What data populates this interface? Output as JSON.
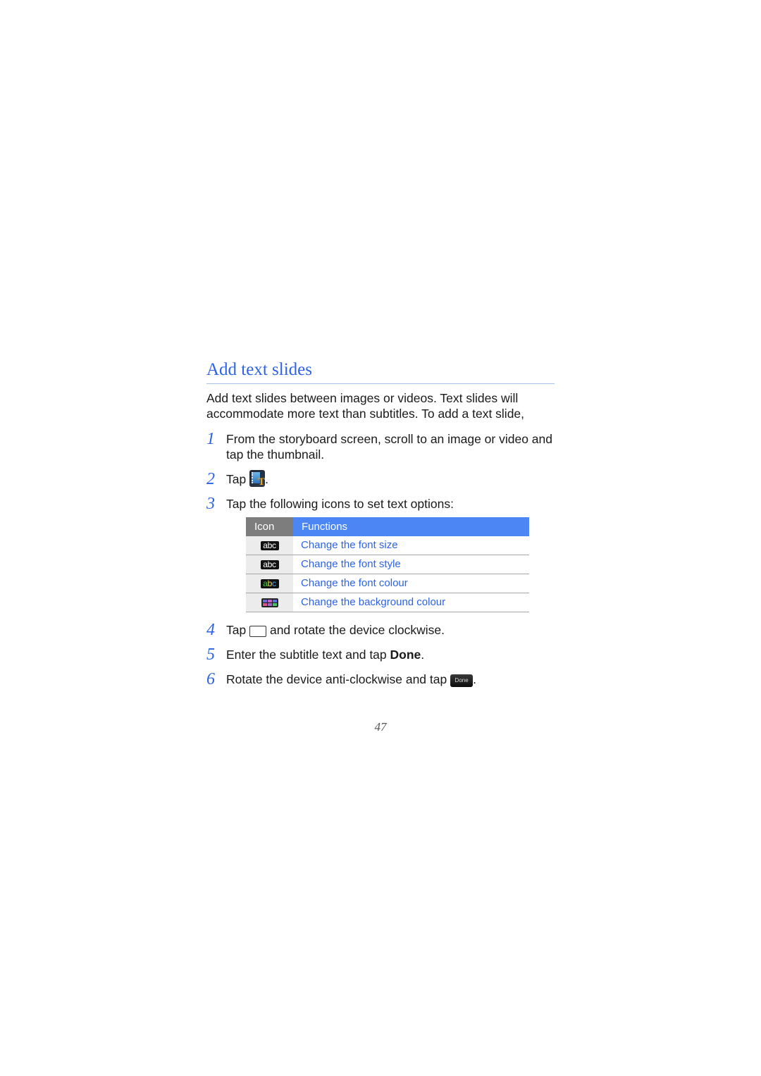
{
  "section": {
    "title": "Add text slides",
    "intro": "Add text slides between images or videos. Text slides will accommodate more text than subtitles. To add a text slide,"
  },
  "steps": [
    {
      "number": "1",
      "text": "From the storyboard screen, scroll to an image or video and tap the thumbnail."
    },
    {
      "number": "2",
      "before": "Tap",
      "icon": "text-slide-icon",
      "after": "."
    },
    {
      "number": "3",
      "text": "Tap the following icons to set text options:"
    },
    {
      "number": "4",
      "before": "Tap",
      "icon": "keyboard-icon",
      "after": "and rotate the device clockwise."
    },
    {
      "number": "5",
      "before": "Enter the subtitle text and tap",
      "bold": "Done",
      "after": "."
    },
    {
      "number": "6",
      "before": "Rotate the device anti-clockwise and tap",
      "icon": "done-button-icon",
      "icon_label": "Done",
      "after": "."
    }
  ],
  "table": {
    "headers": {
      "icon": "Icon",
      "functions": "Functions"
    },
    "rows": [
      {
        "icon": "font-size-icon",
        "icon_text": "abc",
        "function": "Change the font size"
      },
      {
        "icon": "font-style-icon",
        "icon_text": "abc",
        "function": "Change the font style"
      },
      {
        "icon": "font-colour-icon",
        "icon_text": "abc",
        "function": "Change the font colour"
      },
      {
        "icon": "background-colour-icon",
        "icon_text": "",
        "function": "Change the background colour"
      }
    ]
  },
  "colors": {
    "accent": "#2c63e6",
    "table_header_icon": "#7d7d7d",
    "table_header_functions": "#4c86f5",
    "title_rule": "#a9c3f0"
  },
  "page_number": "47"
}
